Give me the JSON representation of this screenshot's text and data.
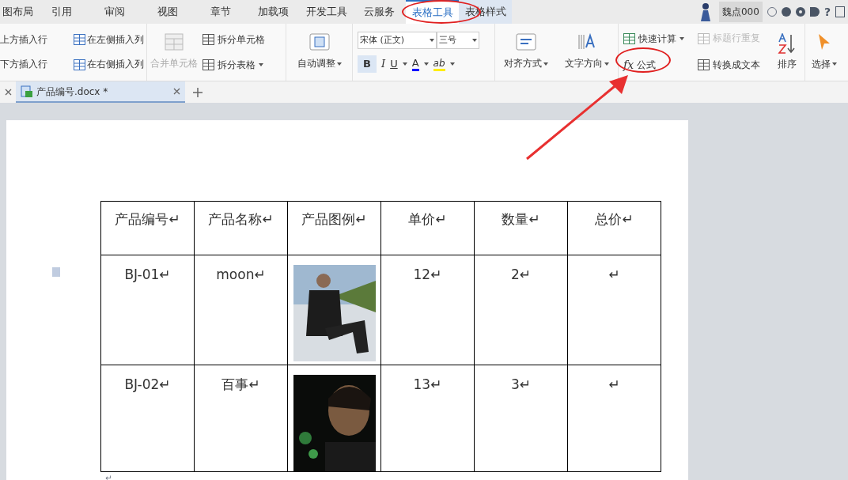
{
  "menu_tabs": [
    {
      "label": "图布局",
      "selected": false
    },
    {
      "label": "引用",
      "selected": false
    },
    {
      "label": "审阅",
      "selected": false
    },
    {
      "label": "视图",
      "selected": false
    },
    {
      "label": "章节",
      "selected": false
    },
    {
      "label": "加载项",
      "selected": false
    },
    {
      "label": "开发工具",
      "selected": false
    },
    {
      "label": "云服务",
      "selected": false
    },
    {
      "label": "表格工具",
      "selected": true
    },
    {
      "label": "表格样式",
      "selected": false
    }
  ],
  "user": {
    "name": "魏点000",
    "help": "?"
  },
  "ribbon": {
    "insert": [
      "上方插入行",
      "在左侧插入列",
      "下方插入行",
      "在右侧插入列"
    ],
    "merge": {
      "merge_cells": "合并单元格",
      "disabled": true,
      "split_cell": "拆分单元格",
      "split_table": "拆分表格"
    },
    "autofit": "自动调整",
    "font": {
      "family": "宋体 (正文)",
      "size": "三号",
      "bold": "B",
      "bold_on": true,
      "italic": "I",
      "underline": "U",
      "font_color_letter": "A",
      "highlight": "ab"
    },
    "align": "对齐方式",
    "direction": "文字方向",
    "calc": {
      "quick": "快速计算",
      "repeat_header": "标题行重复",
      "repeat_disabled": true,
      "formula": "公式",
      "formula_fx": "fx",
      "convert": "转换成文本",
      "sort": "排序"
    },
    "select": "选择"
  },
  "doc_tabs": [
    {
      "label": "产品编号.docx *",
      "selected": true
    }
  ],
  "table": {
    "columns": [
      "产品编号↵",
      "产品名称↵",
      "产品图例↵",
      "单价↵",
      "数量↵",
      "总价↵"
    ],
    "rows": [
      {
        "cells": [
          "BJ-01↵",
          "moon↵",
          {
            "kind": "picture"
          },
          "12↵",
          "2↵",
          "↵"
        ]
      },
      {
        "cells": [
          "BJ-02↵",
          "百事↵",
          {
            "kind": "picture"
          },
          "13↵",
          "3↵",
          "↵"
        ]
      }
    ]
  },
  "after_table_mark": "↵"
}
